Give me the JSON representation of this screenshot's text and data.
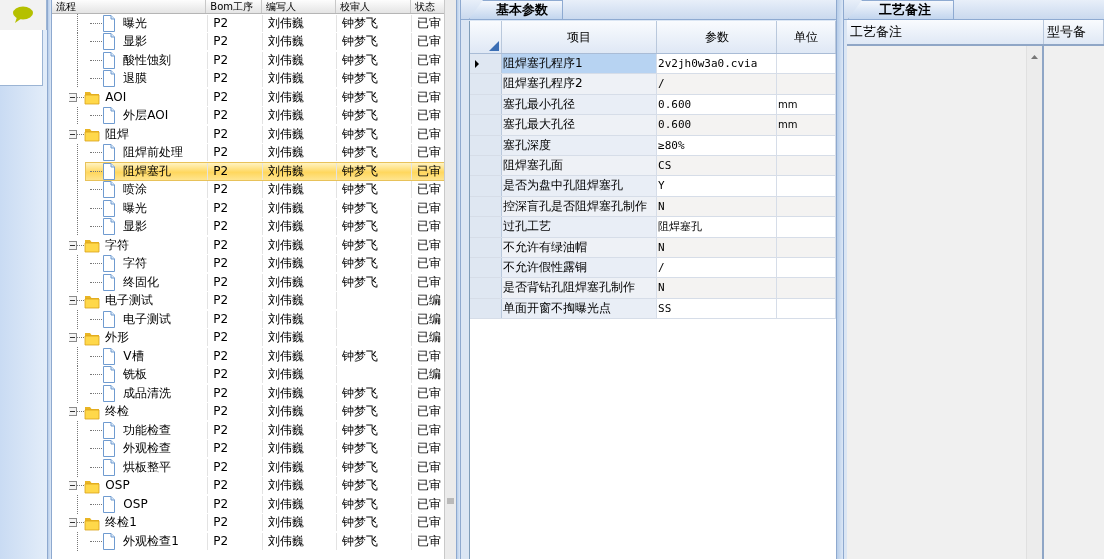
{
  "tree": {
    "columns": [
      "流程",
      "Bom工序",
      "编写人",
      "校审人",
      "状态"
    ],
    "nodes": [
      {
        "kind": "offscreen",
        "children": [
          {
            "kind": "file",
            "label": "曝光",
            "bom": "P2",
            "author": "刘伟巍",
            "reviewer": "钟梦飞",
            "status": "已审",
            "selected": false
          },
          {
            "kind": "file",
            "label": "显影",
            "bom": "P2",
            "author": "刘伟巍",
            "reviewer": "钟梦飞",
            "status": "已审",
            "selected": false
          },
          {
            "kind": "file",
            "label": "酸性蚀刻",
            "bom": "P2",
            "author": "刘伟巍",
            "reviewer": "钟梦飞",
            "status": "已审",
            "selected": false
          },
          {
            "kind": "file",
            "label": "退膜",
            "bom": "P2",
            "author": "刘伟巍",
            "reviewer": "钟梦飞",
            "status": "已审",
            "selected": false
          }
        ]
      },
      {
        "kind": "folder",
        "label": "AOI",
        "bom": "P2",
        "author": "刘伟巍",
        "reviewer": "钟梦飞",
        "status": "已审",
        "expanded": true,
        "selected": false,
        "children": [
          {
            "kind": "file",
            "label": "外层AOI",
            "bom": "P2",
            "author": "刘伟巍",
            "reviewer": "钟梦飞",
            "status": "已审",
            "selected": false
          }
        ]
      },
      {
        "kind": "folder",
        "label": "阻焊",
        "bom": "P2",
        "author": "刘伟巍",
        "reviewer": "钟梦飞",
        "status": "已审",
        "expanded": true,
        "selected": false,
        "children": [
          {
            "kind": "file",
            "label": "阻焊前处理",
            "bom": "P2",
            "author": "刘伟巍",
            "reviewer": "钟梦飞",
            "status": "已审",
            "selected": false
          },
          {
            "kind": "file",
            "label": "阻焊塞孔",
            "bom": "P2",
            "author": "刘伟巍",
            "reviewer": "钟梦飞",
            "status": "已审",
            "selected": true
          },
          {
            "kind": "file",
            "label": "喷涂",
            "bom": "P2",
            "author": "刘伟巍",
            "reviewer": "钟梦飞",
            "status": "已审",
            "selected": false
          },
          {
            "kind": "file",
            "label": "曝光",
            "bom": "P2",
            "author": "刘伟巍",
            "reviewer": "钟梦飞",
            "status": "已审",
            "selected": false
          },
          {
            "kind": "file",
            "label": "显影",
            "bom": "P2",
            "author": "刘伟巍",
            "reviewer": "钟梦飞",
            "status": "已审",
            "selected": false
          }
        ]
      },
      {
        "kind": "folder",
        "label": "字符",
        "bom": "P2",
        "author": "刘伟巍",
        "reviewer": "钟梦飞",
        "status": "已审",
        "expanded": true,
        "selected": false,
        "children": [
          {
            "kind": "file",
            "label": "字符",
            "bom": "P2",
            "author": "刘伟巍",
            "reviewer": "钟梦飞",
            "status": "已审",
            "selected": false
          },
          {
            "kind": "file",
            "label": "终固化",
            "bom": "P2",
            "author": "刘伟巍",
            "reviewer": "钟梦飞",
            "status": "已审",
            "selected": false
          }
        ]
      },
      {
        "kind": "folder",
        "label": "电子测试",
        "bom": "P2",
        "author": "刘伟巍",
        "status": "已编",
        "expanded": true,
        "selected": false,
        "children": [
          {
            "kind": "file",
            "label": "电子测试",
            "bom": "P2",
            "author": "刘伟巍",
            "status": "已编",
            "selected": false
          }
        ]
      },
      {
        "kind": "folder",
        "label": "外形",
        "bom": "P2",
        "author": "刘伟巍",
        "status": "已编",
        "expanded": true,
        "selected": false,
        "children": [
          {
            "kind": "file",
            "label": "V槽",
            "bom": "P2",
            "author": "刘伟巍",
            "reviewer": "钟梦飞",
            "status": "已审",
            "selected": false
          },
          {
            "kind": "file",
            "label": "铣板",
            "bom": "P2",
            "author": "刘伟巍",
            "status": "已编",
            "selected": false
          },
          {
            "kind": "file",
            "label": "成品清洗",
            "bom": "P2",
            "author": "刘伟巍",
            "reviewer": "钟梦飞",
            "status": "已审",
            "selected": false
          }
        ]
      },
      {
        "kind": "folder",
        "label": "终检",
        "bom": "P2",
        "author": "刘伟巍",
        "reviewer": "钟梦飞",
        "status": "已审",
        "expanded": true,
        "selected": false,
        "children": [
          {
            "kind": "file",
            "label": "功能检查",
            "bom": "P2",
            "author": "刘伟巍",
            "reviewer": "钟梦飞",
            "status": "已审",
            "selected": false
          },
          {
            "kind": "file",
            "label": "外观检查",
            "bom": "P2",
            "author": "刘伟巍",
            "reviewer": "钟梦飞",
            "status": "已审",
            "selected": false
          },
          {
            "kind": "file",
            "label": "烘板整平",
            "bom": "P2",
            "author": "刘伟巍",
            "reviewer": "钟梦飞",
            "status": "已审",
            "selected": false
          }
        ]
      },
      {
        "kind": "folder",
        "label": "OSP",
        "bom": "P2",
        "author": "刘伟巍",
        "reviewer": "钟梦飞",
        "status": "已审",
        "expanded": true,
        "selected": false,
        "children": [
          {
            "kind": "file",
            "label": "OSP",
            "bom": "P2",
            "author": "刘伟巍",
            "reviewer": "钟梦飞",
            "status": "已审",
            "selected": false
          }
        ]
      },
      {
        "kind": "folder",
        "label": "终检1",
        "bom": "P2",
        "author": "刘伟巍",
        "reviewer": "钟梦飞",
        "status": "已审",
        "expanded": true,
        "selected": false,
        "children": [
          {
            "kind": "file",
            "label": "外观检查1",
            "bom": "P2",
            "author": "刘伟巍",
            "reviewer": "钟梦飞",
            "status": "已审",
            "selected": false
          }
        ]
      }
    ]
  },
  "params": {
    "tab": {
      "label": "基本参数",
      "selected": true
    },
    "columns": [
      "项目",
      "参数",
      "单位"
    ],
    "rows": [
      {
        "item": "阻焊塞孔程序1",
        "value": "2v2jh0w3a0.cvia",
        "selected": true
      },
      {
        "item": "阻焊塞孔程序2",
        "value": "/",
        "selected": false
      },
      {
        "item": "塞孔最小孔径",
        "value": "0.600",
        "unit": "mm",
        "selected": false
      },
      {
        "item": "塞孔最大孔径",
        "value": "0.600",
        "unit": "mm",
        "selected": false
      },
      {
        "item": "塞孔深度",
        "value": "≥80%",
        "selected": false
      },
      {
        "item": "阻焊塞孔面",
        "value": "CS",
        "selected": false
      },
      {
        "item": "是否为盘中孔阻焊塞孔",
        "value": "Y",
        "selected": false
      },
      {
        "item": "控深盲孔是否阻焊塞孔制作",
        "value": "N",
        "selected": false
      },
      {
        "item": "过孔工艺",
        "value": "阻焊塞孔",
        "selected": false
      },
      {
        "item": "不允许有绿油帽",
        "value": "N",
        "selected": false
      },
      {
        "item": "不允许假性露铜",
        "value": "/",
        "selected": false
      },
      {
        "item": "是否背钻孔阻焊塞孔制作",
        "value": "N",
        "selected": false
      },
      {
        "item": "单面开窗不掏曝光点",
        "value": "SS",
        "selected": false
      }
    ]
  },
  "notes": {
    "tab": {
      "label": "工艺备注",
      "selected": true
    },
    "columns": [
      "工艺备注",
      "型号备"
    ]
  }
}
